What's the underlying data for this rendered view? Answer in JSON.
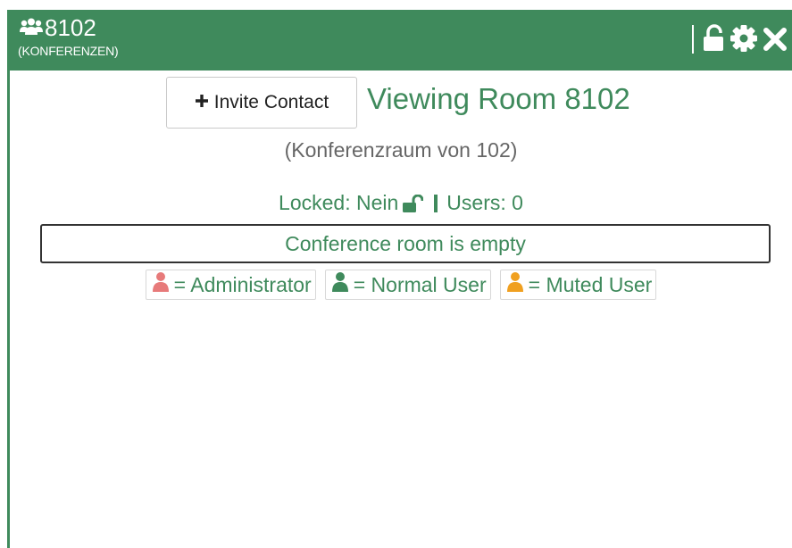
{
  "header": {
    "title": "8102",
    "subtitle": "(KONFERENZEN)",
    "icons": [
      "users-icon",
      "unlock-icon",
      "gear-icon",
      "close-icon"
    ]
  },
  "main": {
    "invite_label": "Invite Contact",
    "view_title": "Viewing Room 8102",
    "room_desc": "(Konferenzraum von 102)",
    "locked_text": "Locked: Nein",
    "users_text": "Users: 0",
    "empty_text": "Conference room is empty"
  },
  "legend": {
    "admin": "= Administrator",
    "normal": "= Normal User",
    "muted": "= Muted User"
  },
  "colors": {
    "brand": "#3f8a5c",
    "admin": "#e77a7a",
    "normal": "#3f8a5c",
    "muted": "#f0a020"
  }
}
